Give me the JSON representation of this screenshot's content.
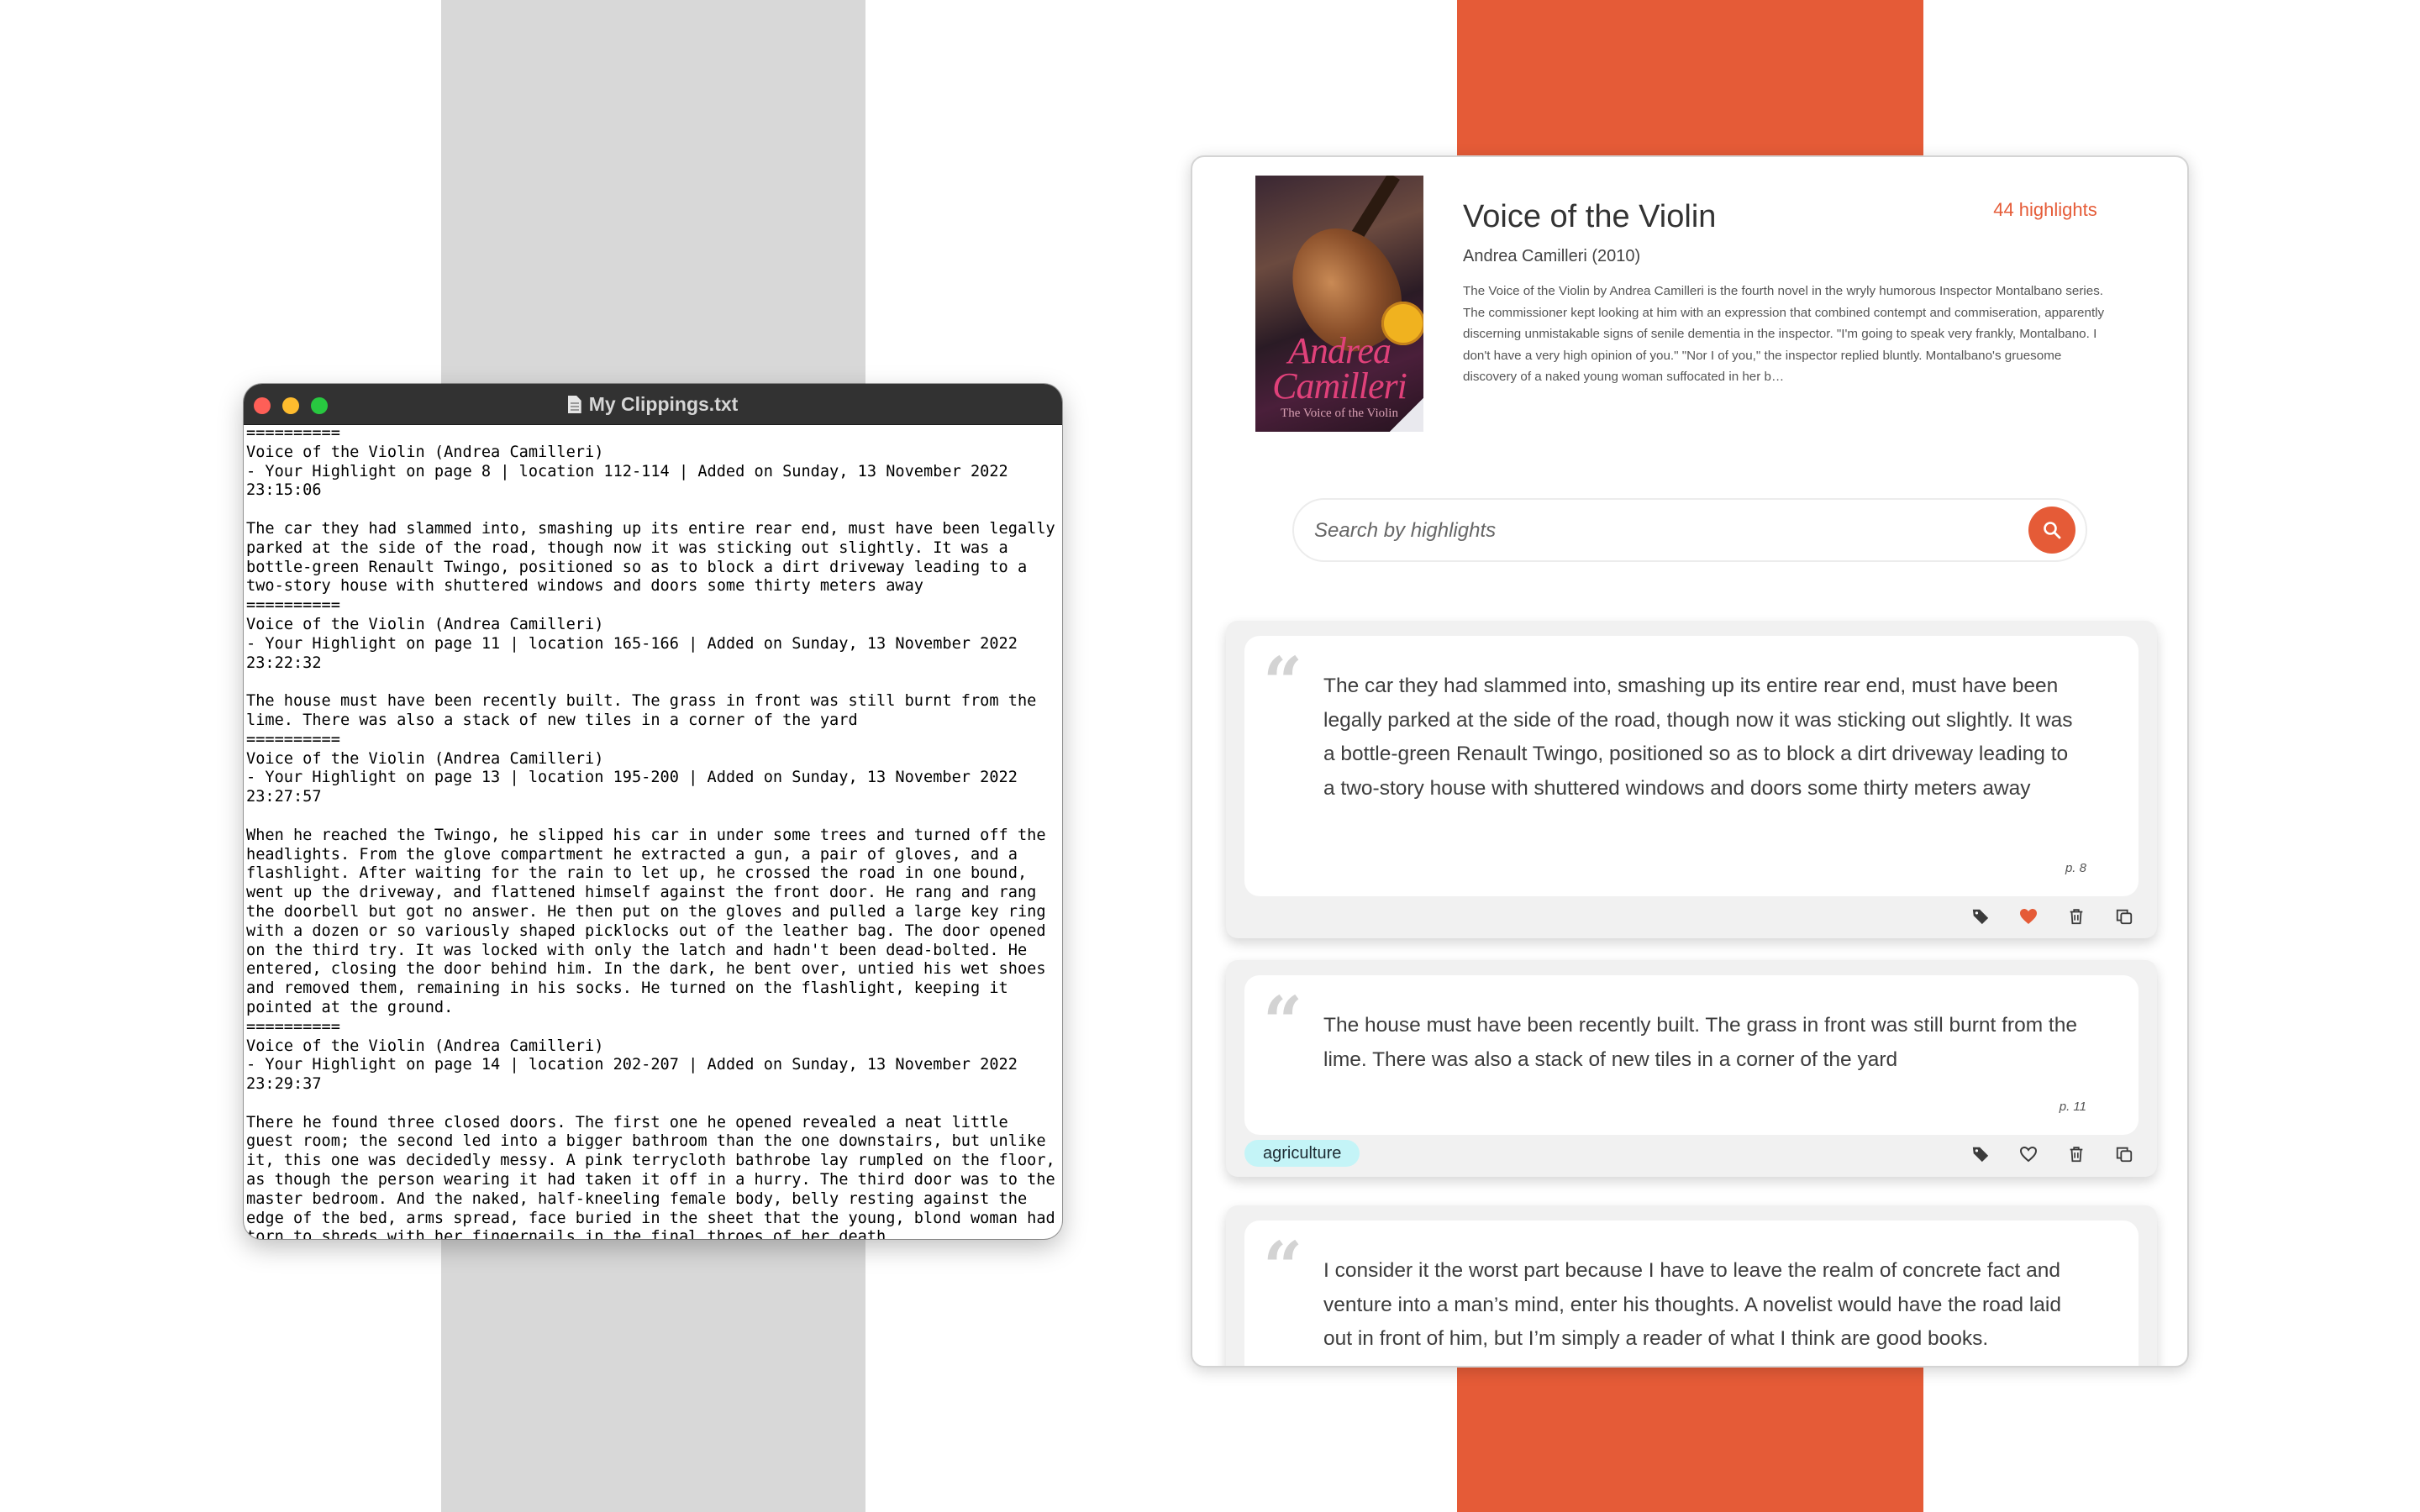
{
  "editor": {
    "title": "My Clippings.txt",
    "content": "==========\nVoice of the Violin (Andrea Camilleri)\n- Your Highlight on page 8 | location 112-114 | Added on Sunday, 13 November 2022\n23:15:06\n\nThe car they had slammed into, smashing up its entire rear end, must have been legally parked at the side of the road, though now it was sticking out slightly. It was a bottle-green Renault Twingo, positioned so as to block a dirt driveway leading to a two-story house with shuttered windows and doors some thirty meters away\n==========\nVoice of the Violin (Andrea Camilleri)\n- Your Highlight on page 11 | location 165-166 | Added on Sunday, 13 November 2022\n23:22:32\n\nThe house must have been recently built. The grass in front was still burnt from the lime. There was also a stack of new tiles in a corner of the yard\n==========\nVoice of the Violin (Andrea Camilleri)\n- Your Highlight on page 13 | location 195-200 | Added on Sunday, 13 November 2022\n23:27:57\n\nWhen he reached the Twingo, he slipped his car in under some trees and turned off the headlights. From the glove compartment he extracted a gun, a pair of gloves, and a flashlight. After waiting for the rain to let up, he crossed the road in one bound, went up the driveway, and flattened himself against the front door. He rang and rang the doorbell but got no answer. He then put on the gloves and pulled a large key ring with a dozen or so variously shaped picklocks out of the leather bag. The door opened on the third try. It was locked with only the latch and hadn't been dead-bolted. He entered, closing the door behind him. In the dark, he bent over, untied his wet shoes and removed them, remaining in his socks. He turned on the flashlight, keeping it pointed at the ground.\n==========\nVoice of the Violin (Andrea Camilleri)\n- Your Highlight on page 14 | location 202-207 | Added on Sunday, 13 November 2022\n23:29:37\n\nThere he found three closed doors. The first one he opened revealed a neat little guest room; the second led into a bigger bathroom than the one downstairs, but unlike it, this one was decidedly messy. A pink terrycloth bathrobe lay rumpled on the floor, as though the person wearing it had taken it off in a hurry. The third door was to the master bedroom. And the naked, half-kneeling female body, belly resting against the edge of the bed, arms spread, face buried in the sheet that the young, blond woman had torn to shreds with her fingernails in the final throes of her death"
  },
  "book": {
    "title": "Voice of the Violin",
    "author_year": "Andrea Camilleri (2010)",
    "highlight_count": "44 highlights",
    "description": "The Voice of the Violin by Andrea Camilleri is the fourth novel in the wryly humorous Inspector Montalbano series. The commissioner kept looking at him with an expression that combined contempt and commiseration, apparently discerning unmistakable signs of senile dementia in the inspector. \"I'm going to speak very frankly, Montalbano. I don't have a very high opinion of you.\" \"Nor I of you,\" the inspector replied bluntly. Montalbano's gruesome discovery of a naked young woman suffocated in her b…",
    "cover_author": "Andrea Camilleri",
    "cover_subtitle": "The Voice of the Violin"
  },
  "search": {
    "placeholder": "Search by highlights",
    "icon": "search-icon"
  },
  "highlights": [
    {
      "text": "The car they had slammed into, smashing up its entire rear end, must have been legally parked at the side of the road, though now it was sticking out slightly. It was a bottle-green Renault Twingo, positioned so as to block a dirt driveway leading to a two-story house with shuttered windows and doors some thirty meters away",
      "page": "p. 8",
      "favorite": true,
      "tags": []
    },
    {
      "text": "The house must have been recently built. The grass in front was still burnt from the lime. There was also a stack of new tiles in a corner of the yard",
      "page": "p. 11",
      "favorite": false,
      "tags": [
        "agriculture"
      ]
    },
    {
      "text": "I consider it the worst part because I have to leave the realm of concrete fact and venture into a man’s mind, enter his thoughts. A novelist would have the road laid out in front of him, but I’m simply a reader of what I think are good books.",
      "page": "",
      "favorite": false,
      "tags": []
    }
  ],
  "colors": {
    "accent": "#e55b37",
    "tag_bg": "#c4f4f7",
    "card_bg": "#f1f1f1"
  }
}
